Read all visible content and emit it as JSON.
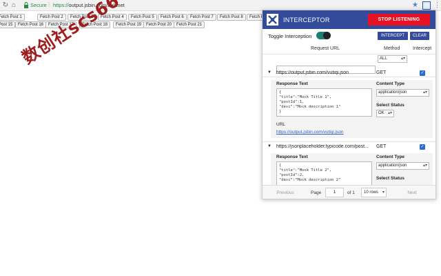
{
  "browser": {
    "secure_label": "Secure",
    "url_protocol": "https://",
    "url_rest": "output.jsbin.com/bulunet"
  },
  "fetch_buttons": [
    "Fetch Post 1",
    "Fetch Post 2",
    "Fetch Post 3",
    "Fetch Post 4",
    "Fetch Post 5",
    "Fetch Post 6",
    "Fetch Post 7",
    "Fetch Post 8",
    "Fetch Po",
    "Post 15",
    "Fetch Post 16",
    "Fetch Post 17",
    "Fetch Post 18",
    "Fetch Post 19",
    "Fetch Post 20",
    "Fetch Post 21"
  ],
  "watermark": "数创社scs66",
  "panel": {
    "title": "INTERCEPTOR",
    "stop_label": "STOP LISTENING",
    "toggle_label": "Toggle Interception",
    "toggle_on": true,
    "intercept_label": "INTERCEPT",
    "clear_label": "CLEAR",
    "columns": {
      "url": "Request URL",
      "method": "Method",
      "intercept": "Intercept"
    },
    "method_filter": "ALL",
    "rows": [
      {
        "url": "https://output.jsbin.com/vutiqi.json",
        "method": "GET",
        "checked": true,
        "expanded": true,
        "response_label": "Response Text",
        "response_text": "{\n\"title\":\"Mock Title 1\",\n\"postId\":1,\n\"desc\":\"Mock description 1\"\n}",
        "content_type_label": "Content Type",
        "content_type": "application/json",
        "status_label": "Select Status",
        "status": "OK",
        "url_label": "URL",
        "link": "https://output.jsbin.com/vutiqi.json"
      },
      {
        "url": "https://jsonplaceholder.typicode.com/post...",
        "method": "GET",
        "checked": true,
        "expanded": true,
        "response_label": "Response Text",
        "response_text": "{\n\"title\":\"Mock Title 2\",\n\"postId\":2,\n\"desc\":\"Mock description 2\"",
        "content_type_label": "Content Type",
        "content_type": "application/json",
        "status_label": "Select Status"
      }
    ],
    "pagination": {
      "prev": "Previous",
      "page_label": "Page",
      "page": "1",
      "of_label": "of 1",
      "rows": "10 rows",
      "next": "Next"
    }
  },
  "colors": {
    "header": "#344a9a",
    "stop": "#e81123",
    "toggle": "#1a7f6b",
    "link": "#2a5fd0",
    "watermark": "#a01d1d"
  }
}
